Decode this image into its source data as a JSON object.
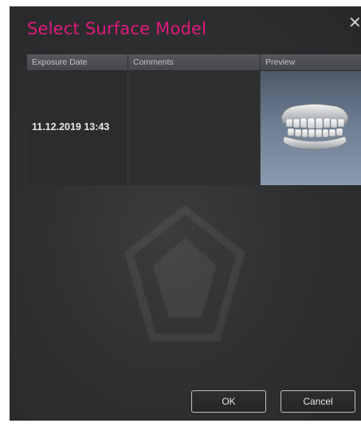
{
  "dialog": {
    "title": "Select Surface Model",
    "close_label": "✕"
  },
  "table": {
    "columns": [
      "Exposure Date",
      "Comments",
      "Preview"
    ],
    "rows": [
      {
        "exposure_date": "11.12.2019 13:43",
        "comments": "",
        "preview": "dental-scan-model-thumbnail"
      }
    ]
  },
  "buttons": {
    "ok_label": "OK",
    "cancel_label": "Cancel"
  },
  "colors": {
    "title_accent": "#e0197e",
    "dialog_background": "#303133",
    "header_background": "#4e4f52"
  }
}
